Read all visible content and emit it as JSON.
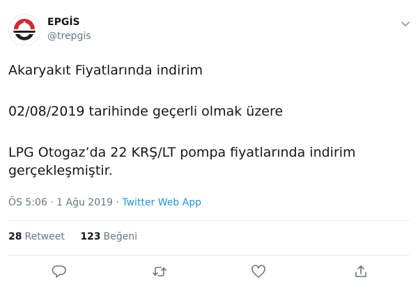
{
  "author": {
    "display_name": "EPGİS",
    "handle": "@trepgis"
  },
  "tweet": {
    "line1": "Akaryakıt Fiyatlarında indirim",
    "line2": "02/08/2019 tarihinde geçerli olmak üzere",
    "line3": "LPG Otogaz’da 22 KRŞ/LT pompa fiyatlarında indirim gerçekleşmiştir."
  },
  "meta": {
    "time": "ÖS 5:06",
    "separator": " · ",
    "date": "1 Ağu 2019",
    "source": "Twitter Web App"
  },
  "stats": {
    "retweets_count": "28",
    "retweets_label": "Retweet",
    "likes_count": "123",
    "likes_label": "Beğeni"
  },
  "icons": {
    "reply": "reply-icon",
    "retweet": "retweet-icon",
    "like": "heart-icon",
    "share": "share-icon",
    "caret": "chevron-down-icon"
  },
  "colors": {
    "text": "#14171a",
    "secondary": "#657786",
    "link": "#1b95e0",
    "divider": "#e6ecf0",
    "logo_red": "#d7262d",
    "logo_dark": "#1f1f1f"
  }
}
